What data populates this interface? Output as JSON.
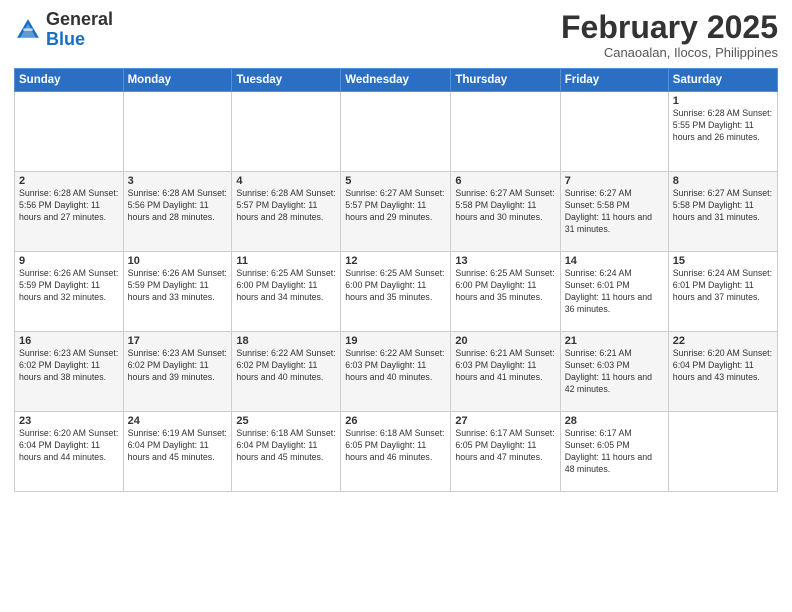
{
  "logo": {
    "general": "General",
    "blue": "Blue"
  },
  "header": {
    "month_year": "February 2025",
    "location": "Canaoalan, Ilocos, Philippines"
  },
  "weekdays": [
    "Sunday",
    "Monday",
    "Tuesday",
    "Wednesday",
    "Thursday",
    "Friday",
    "Saturday"
  ],
  "weeks": [
    [
      {
        "day": "",
        "info": ""
      },
      {
        "day": "",
        "info": ""
      },
      {
        "day": "",
        "info": ""
      },
      {
        "day": "",
        "info": ""
      },
      {
        "day": "",
        "info": ""
      },
      {
        "day": "",
        "info": ""
      },
      {
        "day": "1",
        "info": "Sunrise: 6:28 AM\nSunset: 5:55 PM\nDaylight: 11 hours and 26 minutes."
      }
    ],
    [
      {
        "day": "2",
        "info": "Sunrise: 6:28 AM\nSunset: 5:56 PM\nDaylight: 11 hours and 27 minutes."
      },
      {
        "day": "3",
        "info": "Sunrise: 6:28 AM\nSunset: 5:56 PM\nDaylight: 11 hours and 28 minutes."
      },
      {
        "day": "4",
        "info": "Sunrise: 6:28 AM\nSunset: 5:57 PM\nDaylight: 11 hours and 28 minutes."
      },
      {
        "day": "5",
        "info": "Sunrise: 6:27 AM\nSunset: 5:57 PM\nDaylight: 11 hours and 29 minutes."
      },
      {
        "day": "6",
        "info": "Sunrise: 6:27 AM\nSunset: 5:58 PM\nDaylight: 11 hours and 30 minutes."
      },
      {
        "day": "7",
        "info": "Sunrise: 6:27 AM\nSunset: 5:58 PM\nDaylight: 11 hours and 31 minutes."
      },
      {
        "day": "8",
        "info": "Sunrise: 6:27 AM\nSunset: 5:58 PM\nDaylight: 11 hours and 31 minutes."
      }
    ],
    [
      {
        "day": "9",
        "info": "Sunrise: 6:26 AM\nSunset: 5:59 PM\nDaylight: 11 hours and 32 minutes."
      },
      {
        "day": "10",
        "info": "Sunrise: 6:26 AM\nSunset: 5:59 PM\nDaylight: 11 hours and 33 minutes."
      },
      {
        "day": "11",
        "info": "Sunrise: 6:25 AM\nSunset: 6:00 PM\nDaylight: 11 hours and 34 minutes."
      },
      {
        "day": "12",
        "info": "Sunrise: 6:25 AM\nSunset: 6:00 PM\nDaylight: 11 hours and 35 minutes."
      },
      {
        "day": "13",
        "info": "Sunrise: 6:25 AM\nSunset: 6:00 PM\nDaylight: 11 hours and 35 minutes."
      },
      {
        "day": "14",
        "info": "Sunrise: 6:24 AM\nSunset: 6:01 PM\nDaylight: 11 hours and 36 minutes."
      },
      {
        "day": "15",
        "info": "Sunrise: 6:24 AM\nSunset: 6:01 PM\nDaylight: 11 hours and 37 minutes."
      }
    ],
    [
      {
        "day": "16",
        "info": "Sunrise: 6:23 AM\nSunset: 6:02 PM\nDaylight: 11 hours and 38 minutes."
      },
      {
        "day": "17",
        "info": "Sunrise: 6:23 AM\nSunset: 6:02 PM\nDaylight: 11 hours and 39 minutes."
      },
      {
        "day": "18",
        "info": "Sunrise: 6:22 AM\nSunset: 6:02 PM\nDaylight: 11 hours and 40 minutes."
      },
      {
        "day": "19",
        "info": "Sunrise: 6:22 AM\nSunset: 6:03 PM\nDaylight: 11 hours and 40 minutes."
      },
      {
        "day": "20",
        "info": "Sunrise: 6:21 AM\nSunset: 6:03 PM\nDaylight: 11 hours and 41 minutes."
      },
      {
        "day": "21",
        "info": "Sunrise: 6:21 AM\nSunset: 6:03 PM\nDaylight: 11 hours and 42 minutes."
      },
      {
        "day": "22",
        "info": "Sunrise: 6:20 AM\nSunset: 6:04 PM\nDaylight: 11 hours and 43 minutes."
      }
    ],
    [
      {
        "day": "23",
        "info": "Sunrise: 6:20 AM\nSunset: 6:04 PM\nDaylight: 11 hours and 44 minutes."
      },
      {
        "day": "24",
        "info": "Sunrise: 6:19 AM\nSunset: 6:04 PM\nDaylight: 11 hours and 45 minutes."
      },
      {
        "day": "25",
        "info": "Sunrise: 6:18 AM\nSunset: 6:04 PM\nDaylight: 11 hours and 45 minutes."
      },
      {
        "day": "26",
        "info": "Sunrise: 6:18 AM\nSunset: 6:05 PM\nDaylight: 11 hours and 46 minutes."
      },
      {
        "day": "27",
        "info": "Sunrise: 6:17 AM\nSunset: 6:05 PM\nDaylight: 11 hours and 47 minutes."
      },
      {
        "day": "28",
        "info": "Sunrise: 6:17 AM\nSunset: 6:05 PM\nDaylight: 11 hours and 48 minutes."
      },
      {
        "day": "",
        "info": ""
      }
    ]
  ]
}
